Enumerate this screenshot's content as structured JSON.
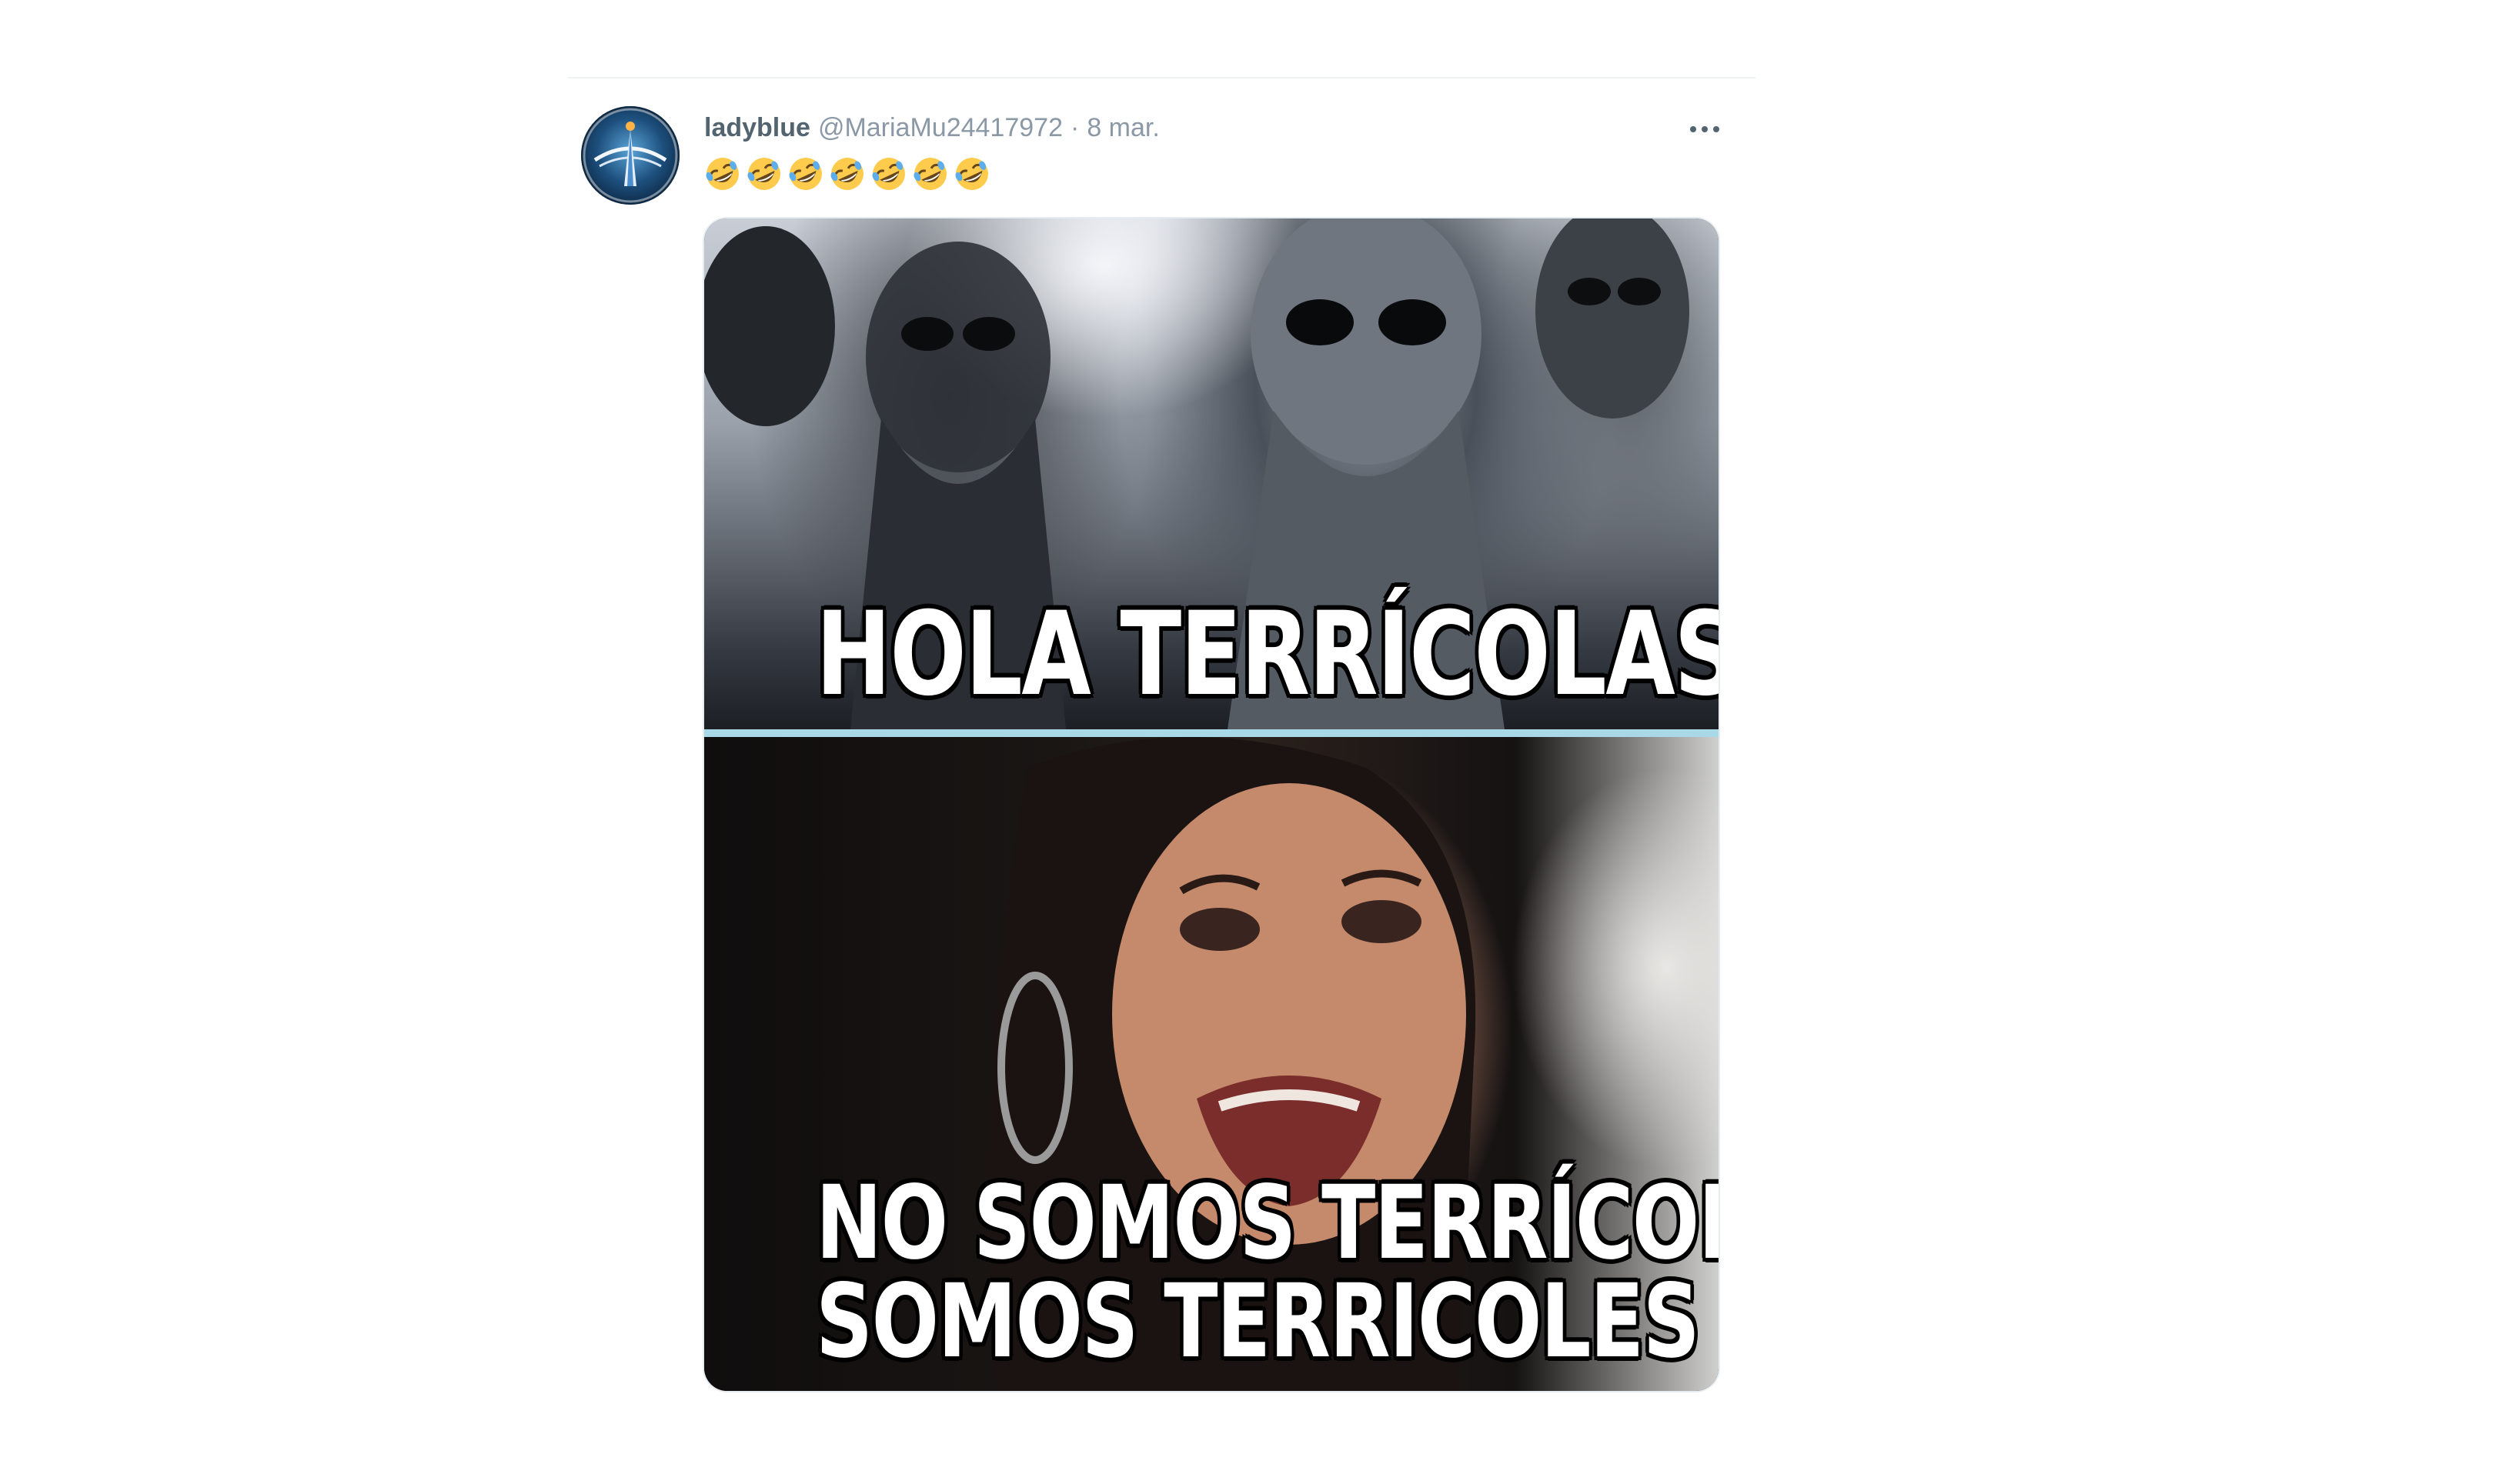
{
  "tweet": {
    "display_name": "ladyblue",
    "handle": "@MariaMu24417972",
    "separator": "·",
    "timestamp": "8 mar.",
    "emoji_text": [
      "rolling-on-the-floor-laughing",
      "rolling-on-the-floor-laughing",
      "rolling-on-the-floor-laughing",
      "rolling-on-the-floor-laughing",
      "rolling-on-the-floor-laughing",
      "rolling-on-the-floor-laughing",
      "rolling-on-the-floor-laughing"
    ],
    "more_icon": "more-horizontal-icon",
    "media": {
      "top_caption": "HOLA TERRÍCOLAS...",
      "bottom_caption_line1": "NO SOMOS TERRÍCOLAS,",
      "bottom_caption_line2": "SOMOS TERRICOLES"
    }
  },
  "colors": {
    "name": "#536471",
    "secondary": "#8b98a5",
    "divider": "#eff3f4",
    "meme_divider": "#a9d8e6"
  }
}
